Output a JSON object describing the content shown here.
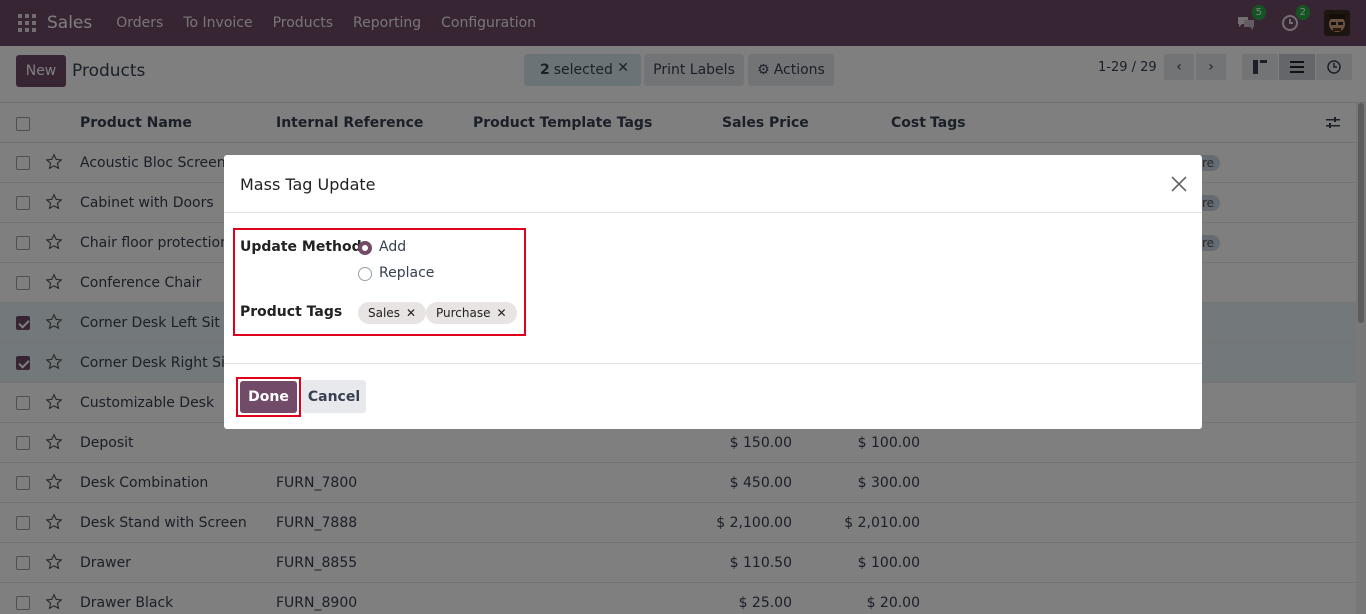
{
  "navbar": {
    "app_name": "Sales",
    "menu": [
      "Orders",
      "To Invoice",
      "Products",
      "Reporting",
      "Configuration"
    ],
    "messages_badge": "5",
    "activities_badge": "2"
  },
  "control": {
    "new_label": "New",
    "title": "Products",
    "selected_count": "2",
    "selected_label": "selected",
    "print_labels": "Print Labels",
    "actions": "Actions",
    "pager": "1-29 / 29"
  },
  "list": {
    "columns": [
      "Product Name",
      "Internal Reference",
      "Product Template Tags",
      "Sales Price",
      "Cost",
      "Tags"
    ],
    "rows": [
      {
        "name": "Acoustic Bloc Screens",
        "ref": "",
        "price": "",
        "cost": "",
        "selected": false
      },
      {
        "name": "Cabinet with Doors",
        "ref": "",
        "price": "",
        "cost": "",
        "selected": false
      },
      {
        "name": "Chair floor protection",
        "ref": "",
        "price": "",
        "cost": "",
        "selected": false
      },
      {
        "name": "Conference Chair",
        "ref": "",
        "price": "",
        "cost": "",
        "selected": false
      },
      {
        "name": "Corner Desk Left Sit",
        "ref": "",
        "price": "",
        "cost": "",
        "selected": true
      },
      {
        "name": "Corner Desk Right Sit",
        "ref": "",
        "price": "",
        "cost": "",
        "selected": true
      },
      {
        "name": "Customizable Desk",
        "ref": "",
        "price": "",
        "cost": "",
        "selected": false
      },
      {
        "name": "Deposit",
        "ref": "",
        "price": "$ 150.00",
        "cost": "$ 100.00",
        "selected": false
      },
      {
        "name": "Desk Combination",
        "ref": "FURN_7800",
        "price": "$ 450.00",
        "cost": "$ 300.00",
        "selected": false
      },
      {
        "name": "Desk Stand with Screen",
        "ref": "FURN_7888",
        "price": "$ 2,100.00",
        "cost": "$ 2,010.00",
        "selected": false
      },
      {
        "name": "Drawer",
        "ref": "FURN_8855",
        "price": "$ 110.50",
        "cost": "$ 100.00",
        "selected": false
      },
      {
        "name": "Drawer Black",
        "ref": "FURN_8900",
        "price": "$ 25.00",
        "cost": "$ 20.00",
        "selected": false
      }
    ],
    "tag_partial": "re"
  },
  "modal": {
    "title": "Mass Tag Update",
    "update_method_label": "Update Method",
    "options": [
      {
        "label": "Add",
        "checked": true
      },
      {
        "label": "Replace",
        "checked": false
      }
    ],
    "product_tags_label": "Product Tags",
    "tags": [
      "Sales",
      "Purchase"
    ],
    "done_label": "Done",
    "cancel_label": "Cancel"
  },
  "colors": {
    "brand": "#714b67",
    "highlight": "#e0001b",
    "selected_row": "#e6f1f4"
  }
}
